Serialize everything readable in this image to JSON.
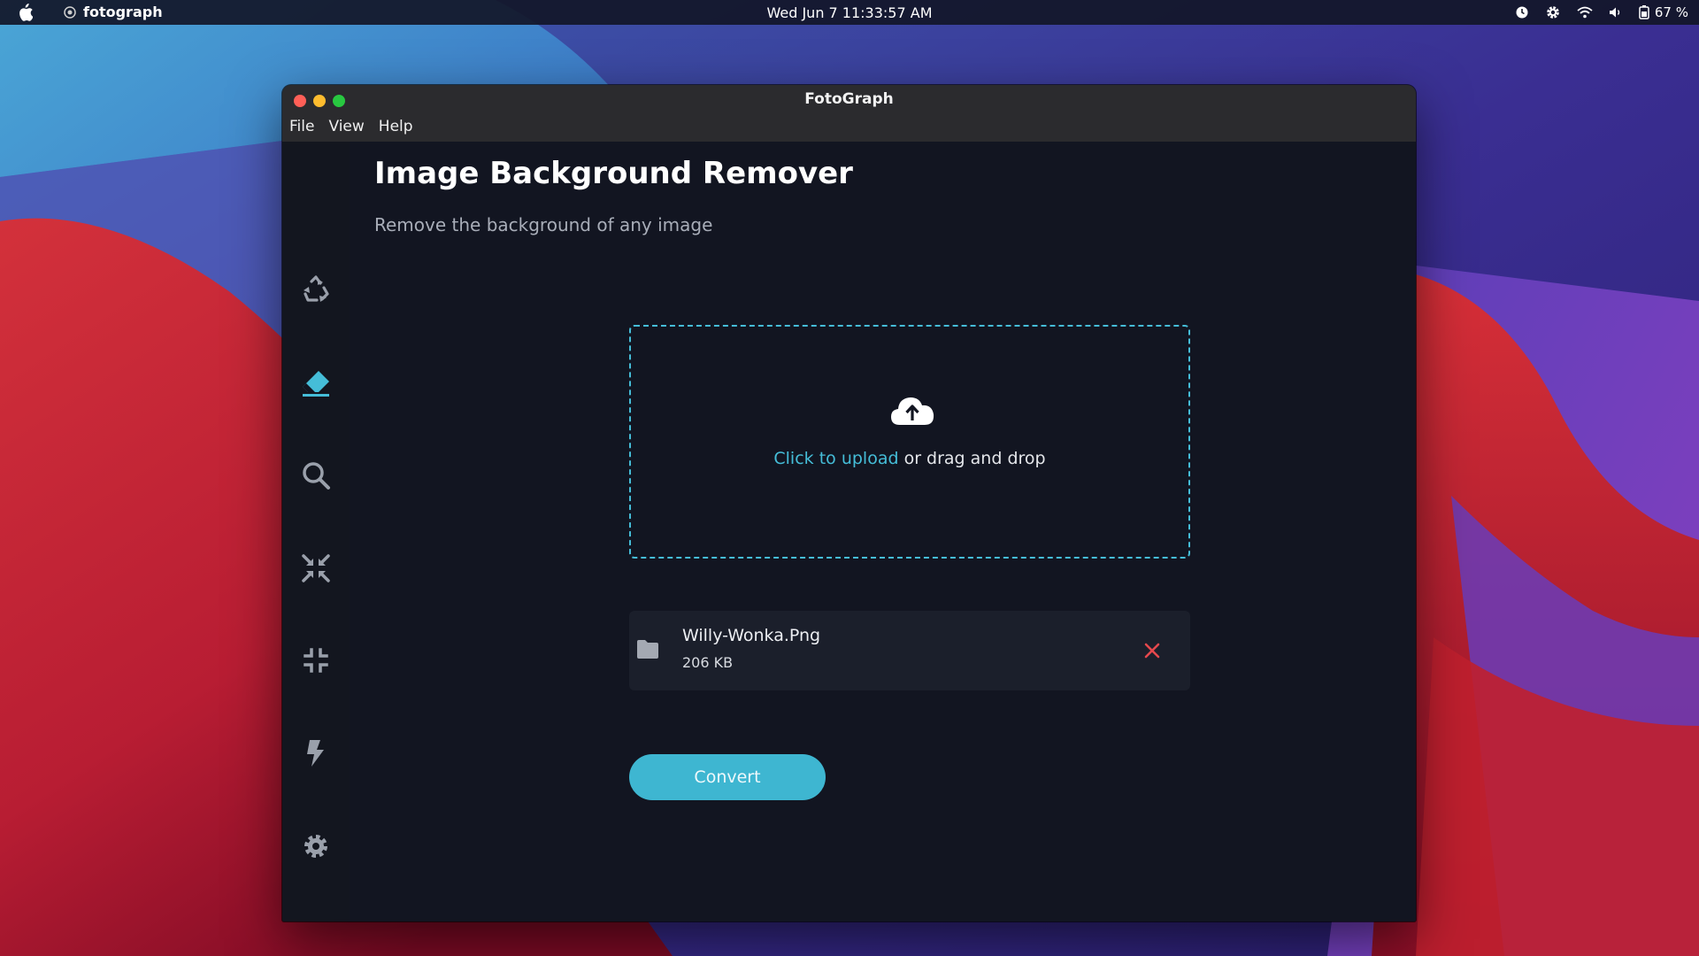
{
  "menubar": {
    "app_name": "fotograph",
    "clock": "Wed Jun 7  11:33:57 AM",
    "battery": "67 %"
  },
  "window": {
    "title": "FotoGraph",
    "menu": [
      "File",
      "View",
      "Help"
    ]
  },
  "sidebar": {
    "items": [
      {
        "icon": "recycle-icon",
        "active": false
      },
      {
        "icon": "eraser-icon",
        "active": true
      },
      {
        "icon": "search-icon",
        "active": false
      },
      {
        "icon": "compress-arrows-icon",
        "active": false
      },
      {
        "icon": "compress-icon",
        "active": false
      },
      {
        "icon": "bolt-icon",
        "active": false
      },
      {
        "icon": "gear-icon",
        "active": false
      },
      {
        "icon": "gift-icon",
        "active": false
      }
    ]
  },
  "main": {
    "title": "Image Background Remover",
    "subtitle": "Remove the background of any image",
    "dropzone": {
      "link_text": "Click to upload",
      "rest_text": " or drag and drop"
    },
    "file": {
      "name": "Willy-Wonka.Png",
      "size": "206 KB"
    },
    "convert_label": "Convert"
  },
  "colors": {
    "accent": "#45bdd8",
    "remove": "#e5484d",
    "window_bg": "#121521",
    "titlebar": "#2b2b2e"
  }
}
